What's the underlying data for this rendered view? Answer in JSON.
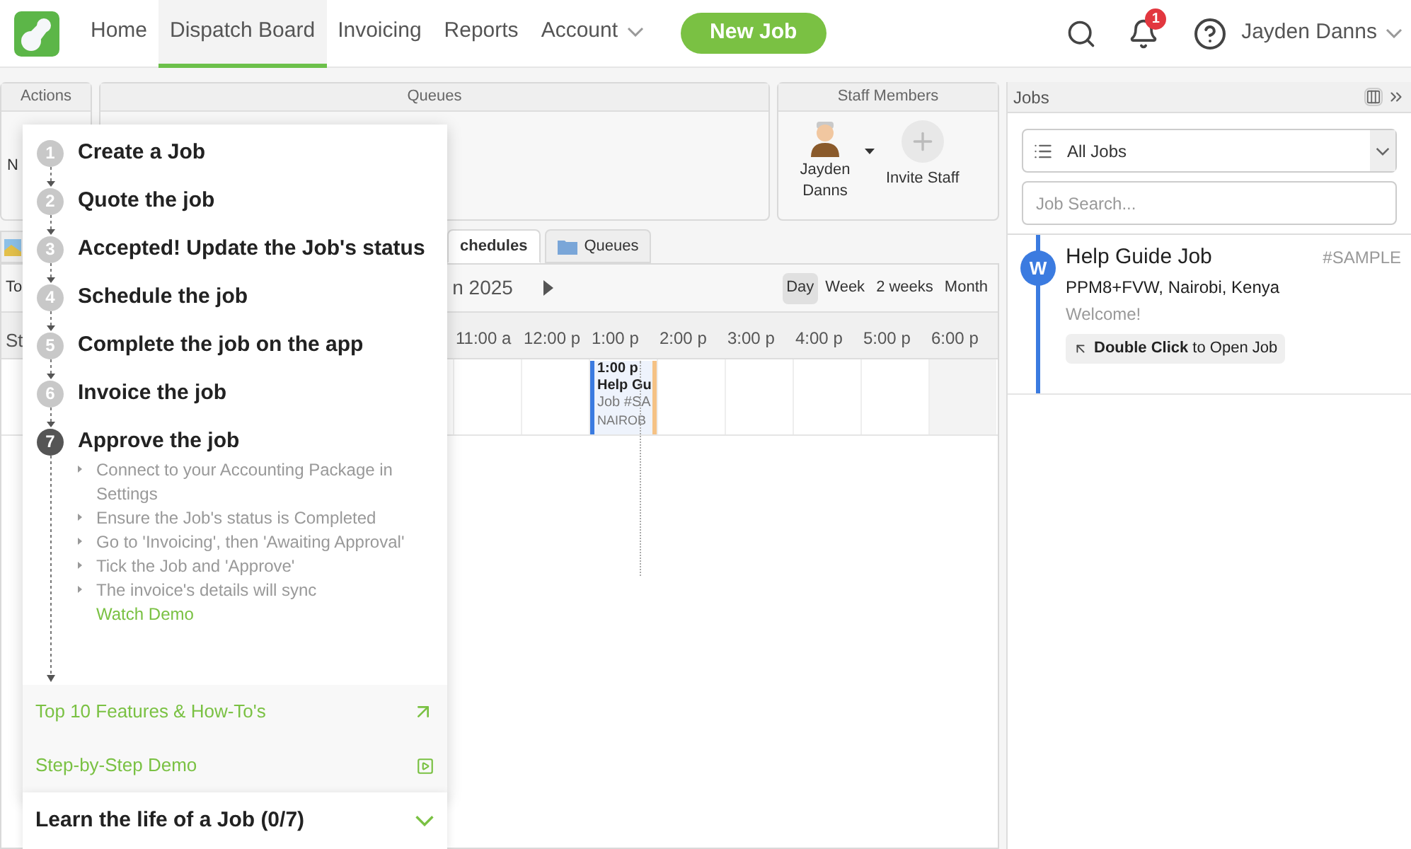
{
  "nav": {
    "items": [
      {
        "label": "Home",
        "selected": false,
        "dropdown": false
      },
      {
        "label": "Dispatch Board",
        "selected": true,
        "dropdown": false
      },
      {
        "label": "Invoicing",
        "selected": false,
        "dropdown": false
      },
      {
        "label": "Reports",
        "selected": false,
        "dropdown": false
      },
      {
        "label": "Account",
        "selected": false,
        "dropdown": true
      }
    ],
    "new_job": "New Job",
    "notification_count": "1",
    "user": "Jayden Danns"
  },
  "panels": {
    "actions": {
      "title": "Actions",
      "fragment": "N"
    },
    "queues": {
      "title": "Queues"
    },
    "staff": {
      "title": "Staff Members",
      "members": [
        {
          "name": "Jayden Danns"
        }
      ],
      "invite": "Invite Staff"
    }
  },
  "tabs": [
    {
      "label": "chedules",
      "selected": true
    },
    {
      "label": "Queues",
      "selected": false
    }
  ],
  "toolbar": {
    "left_fragment": "To",
    "date": "n 2025",
    "views": [
      {
        "label": "Day",
        "selected": true
      },
      {
        "label": "Week",
        "selected": false
      },
      {
        "label": "2 weeks",
        "selected": false
      },
      {
        "label": "Month",
        "selected": false
      }
    ]
  },
  "timeline": {
    "staff_header": "St",
    "hours": [
      "11:00 a",
      "12:00 p",
      "1:00 p",
      "2:00 p",
      "3:00 p",
      "4:00 p",
      "5:00 p",
      "6:00 p"
    ],
    "event": {
      "time": "1:00 p",
      "title": "Help Gu",
      "number": "Job #SA",
      "place": "NAIROB"
    }
  },
  "guide": {
    "steps": [
      {
        "number": "1",
        "label": "Create a Job",
        "expanded": false
      },
      {
        "number": "2",
        "label": "Quote the job",
        "expanded": false
      },
      {
        "number": "3",
        "label": "Accepted! Update the Job's status",
        "expanded": false
      },
      {
        "number": "4",
        "label": "Schedule the job",
        "expanded": false
      },
      {
        "number": "5",
        "label": "Complete the job on the app",
        "expanded": false
      },
      {
        "number": "6",
        "label": "Invoice the job",
        "expanded": false
      },
      {
        "number": "7",
        "label": "Approve the job",
        "expanded": true,
        "details": [
          "Connect to your Accounting Package in Settings",
          "Ensure the Job's status is Completed",
          "Go to 'Invoicing', then 'Awaiting Approval'",
          "Tick the Job and 'Approve'",
          "The invoice's details will sync"
        ],
        "link": "Watch Demo"
      }
    ],
    "links": [
      {
        "label": "Top 10 Features & How-To's",
        "kind": "external"
      },
      {
        "label": "Step-by-Step Demo",
        "kind": "video"
      }
    ],
    "summary": "Learn the life of a Job (0/7)"
  },
  "jobs": {
    "title": "Jobs",
    "filter": "All Jobs",
    "search": {
      "placeholder": "Job Search..."
    },
    "items": [
      {
        "avatar": "W",
        "title": "Help Guide Job",
        "number": "#SAMPLE",
        "address": "PPM8+FVW, Nairobi, Kenya",
        "note": "Welcome!",
        "hint": "**Double Click** to Open Job"
      }
    ]
  }
}
